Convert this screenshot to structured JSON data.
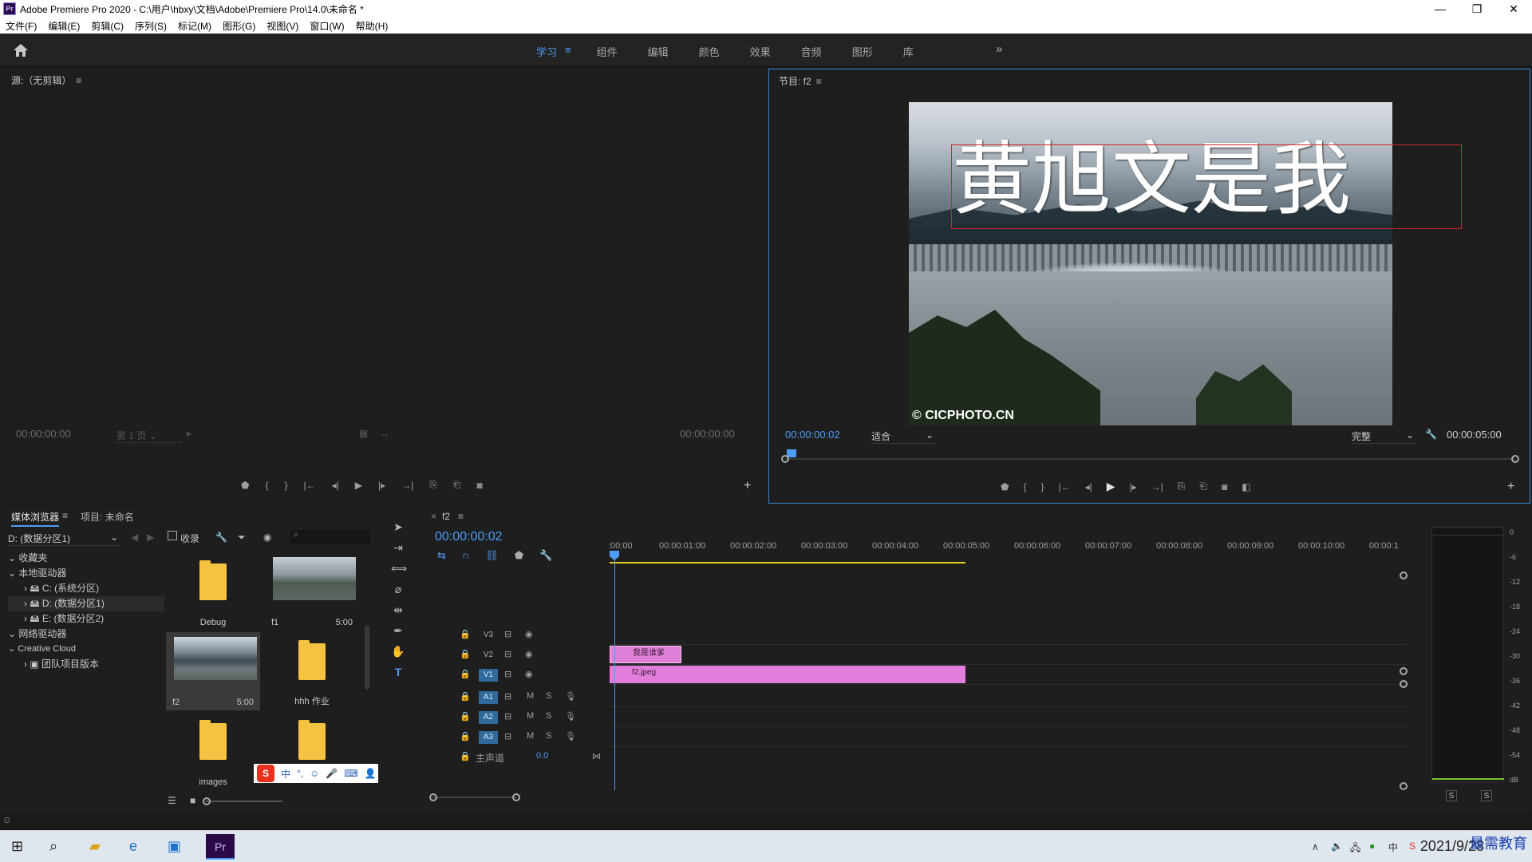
{
  "app": {
    "title": "Adobe Premiere Pro 2020 - C:\\用户\\hbxy\\文档\\Adobe\\Premiere Pro\\14.0\\未命名 *",
    "logo": "Pr"
  },
  "window_controls": [
    "—",
    "❐",
    "✕"
  ],
  "menu": [
    "文件(F)",
    "编辑(E)",
    "剪辑(C)",
    "序列(S)",
    "标记(M)",
    "图形(G)",
    "视图(V)",
    "窗口(W)",
    "帮助(H)"
  ],
  "workspaces": {
    "tabs": [
      "学习",
      "组件",
      "编辑",
      "颜色",
      "效果",
      "音频",
      "图形",
      "库"
    ],
    "active_index": 0,
    "more": "»"
  },
  "source_monitor": {
    "title": "源:（无剪辑）",
    "timecode_left": "00:00:00:00",
    "page_select": "第 1 页",
    "timecode_right": "00:00:00:00"
  },
  "program_monitor": {
    "title": "节目: f2",
    "current_timecode": "00:00:00:02",
    "fit_select": "适合",
    "quality_select": "完整",
    "duration_timecode": "00:00:05:00",
    "overlay_text": "黄旭文是我",
    "watermark": "© CICPHOTO.CN"
  },
  "project_panel": {
    "tabs": [
      "媒体浏览器",
      "项目: 未命名"
    ],
    "drive_select": "D: (数据分区1)",
    "ingest_label": "收录",
    "tree": [
      {
        "label": "收藏夹",
        "level": 0
      },
      {
        "label": "本地驱动器",
        "level": 0
      },
      {
        "label": "C: (系统分区)",
        "level": 1
      },
      {
        "label": "D: (数据分区1)",
        "level": 1
      },
      {
        "label": "E: (数据分区2)",
        "level": 1
      },
      {
        "label": "网络驱动器",
        "level": 0
      },
      {
        "label": "Creative Cloud",
        "level": 0
      },
      {
        "label": "团队项目版本",
        "level": 1
      }
    ],
    "items": [
      {
        "name": "Debug",
        "type": "folder",
        "duration": ""
      },
      {
        "name": "f1",
        "type": "video",
        "duration": "5:00"
      },
      {
        "name": "f2",
        "type": "image",
        "duration": "5:00"
      },
      {
        "name": "hhh 作业",
        "type": "folder",
        "duration": ""
      },
      {
        "name": "images",
        "type": "folder",
        "duration": ""
      },
      {
        "name": "",
        "type": "folder",
        "duration": ""
      }
    ]
  },
  "timeline": {
    "sequence": "f2",
    "timecode": "00:00:00:02",
    "ruler": [
      ":00:00",
      "00:00:01:00",
      "00:00:02:00",
      "00:00:03:00",
      "00:00:04:00",
      "00:00:05:00",
      "00:00:06:00",
      "00:00:07:00",
      "00:00:08:00",
      "00:00:09:00",
      "00:00:10:00",
      "00:00:1"
    ],
    "video_tracks": [
      "V3",
      "V2",
      "V1"
    ],
    "audio_tracks": [
      "A1",
      "A2",
      "A3"
    ],
    "master_label": "主声道",
    "master_value": "0.0",
    "clip_title": "我是谁爹",
    "clip_video": "f2.jpeg",
    "mute_label": "M",
    "solo_label": "S"
  },
  "meter": {
    "scale": [
      "0",
      "-6",
      "-12",
      "-18",
      "-24",
      "-30",
      "-36",
      "-42",
      "-48",
      "-54",
      "dB"
    ],
    "solo_buttons": [
      "S",
      "S"
    ]
  },
  "taskbar": {
    "date": "2021/9/28",
    "brand": "最需教育"
  },
  "ime": {
    "items": [
      "中",
      "°,",
      "☺",
      "🎤",
      "⌨",
      "👤",
      "👕",
      "▦"
    ]
  },
  "colors": {
    "accent": "#4e9cf5",
    "clip_pink": "#e27ddb",
    "work_area": "#e6d21d",
    "title_box": "#d2232a"
  }
}
